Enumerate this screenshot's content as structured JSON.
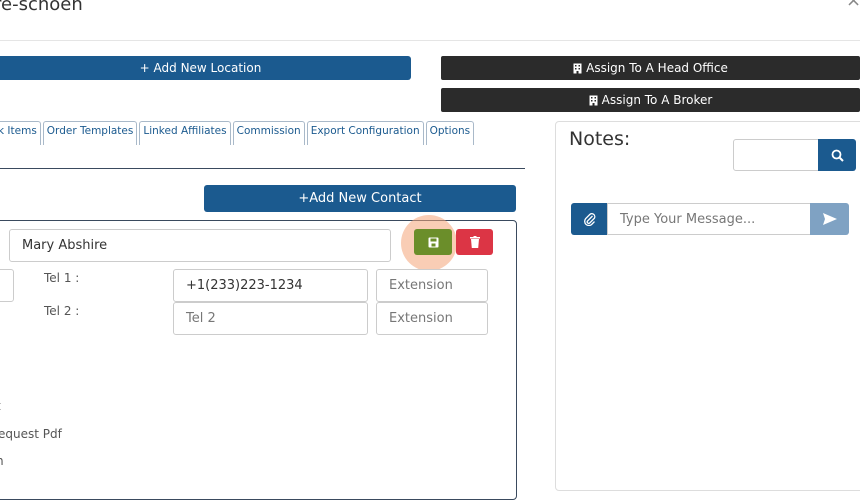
{
  "header": {
    "title": "re-schoen",
    "close_label": "×"
  },
  "actions": {
    "add_location": "+ Add New Location",
    "assign_head_office": "Assign To A Head Office",
    "assign_broker": "Assign To A Broker"
  },
  "tabs": [
    "k Items",
    "Order Templates",
    "Linked Affiliates",
    "Commission",
    "Export Configuration",
    "Options"
  ],
  "contacts": {
    "add_contact": "+Add New Contact",
    "name_value": "Mary Abshire",
    "tel1_label": "Tel 1 :",
    "tel2_label": "Tel 2 :",
    "tel1_value": "+1(233)223-1234",
    "tel2_placeholder": "Tel 2",
    "ext_placeholder": "Extension",
    "left_items": [
      "t",
      "equest Pdf",
      "h"
    ]
  },
  "notes": {
    "title": "Notes:",
    "message_placeholder": "Type Your Message..."
  },
  "colors": {
    "primary": "#1b5a8f",
    "dark": "#2b2b2b",
    "save": "#6b8e2a",
    "delete": "#dc3545",
    "send": "#7fa2c3",
    "highlight": "#f4a478"
  },
  "icons": [
    "building-icon",
    "save-icon",
    "trash-icon",
    "search-icon",
    "paperclip-icon",
    "send-icon",
    "close-icon"
  ]
}
